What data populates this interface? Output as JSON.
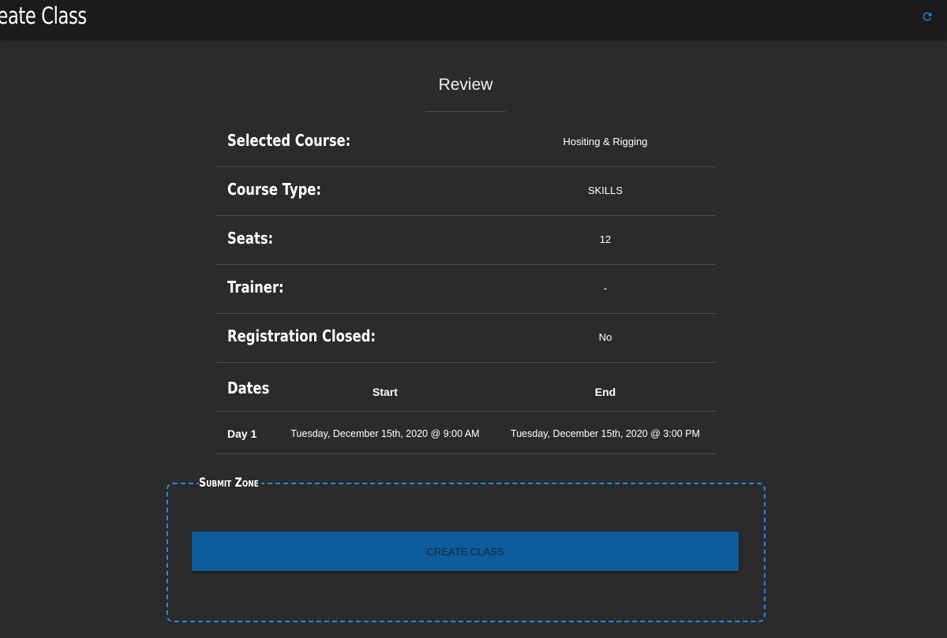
{
  "header": {
    "title": "reate Class",
    "refresh_icon": "refresh-icon"
  },
  "review": {
    "heading": "Review",
    "rows": [
      {
        "label": "Selected Course:",
        "value": "Hositing & Rigging"
      },
      {
        "label": "Course Type:",
        "value": "SKILLS"
      },
      {
        "label": "Seats:",
        "value": "12"
      },
      {
        "label": "Trainer:",
        "value": "-"
      },
      {
        "label": "Registration Closed:",
        "value": "No"
      }
    ],
    "dates": {
      "label": "Dates",
      "start_header": "Start",
      "end_header": "End",
      "days": [
        {
          "label": "Day 1",
          "start": "Tuesday, December 15th, 2020 @ 9:00 AM",
          "end": "Tuesday, December 15th, 2020 @ 3:00 PM"
        }
      ]
    }
  },
  "submit_zone": {
    "legend": "Submit Zone",
    "button_label": "CREATE CLASS"
  },
  "colors": {
    "background": "#2b2b2b",
    "topbar": "#1b1b1b",
    "accent": "#1e88e5",
    "button": "#0d5c99"
  }
}
